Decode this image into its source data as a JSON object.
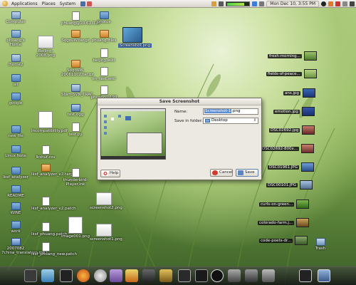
{
  "top_panel": {
    "menus": [
      "Applications",
      "Places",
      "System"
    ],
    "datetime": "Mon Dec 10,  3:55 PM"
  },
  "desktop_left": [
    {
      "label": "Computer",
      "icon": "computer-icon"
    },
    {
      "label": "phuang's Home",
      "icon": "home-icon"
    },
    {
      "label": "/home2",
      "icon": "drive-icon"
    },
    {
      "label": "all",
      "icon": "folder-icon"
    },
    {
      "label": "google",
      "icon": "folder-icon"
    },
    {
      "label": "new file",
      "icon": "folder-icon"
    },
    {
      "label": "Linux Note",
      "icon": "folder-icon"
    },
    {
      "label": "lksf_analyzer",
      "icon": "folder-icon"
    },
    {
      "label": "README",
      "icon": "folder-icon"
    },
    {
      "label": "WINE",
      "icon": "folder-icon"
    },
    {
      "label": "work",
      "icon": "folder-icon"
    },
    {
      "label": "2007082 7china_translation.mp3",
      "icon": "music-file-icon"
    }
  ],
  "desktop_col2": [
    {
      "label": "Beijing-2008.png",
      "icon": "image-file-icon"
    },
    {
      "label": "Incompatibility.pdf",
      "icon": "pdf-file-icon"
    },
    {
      "label": "lkshuf.csv",
      "icon": "document-icon"
    },
    {
      "label": "lksf_analyzer_v2.targz",
      "icon": "archive-icon"
    },
    {
      "label": "lksf_analyzer_v2.patch",
      "icon": "document-icon"
    },
    {
      "label": "lksf_phuang.patch",
      "icon": "document-icon"
    },
    {
      "label": "lksf_phuang_new.patch",
      "icon": "document-icon"
    }
  ],
  "desktop_col3": [
    {
      "label": "phuang@10.61.0.87",
      "icon": "network-icon"
    },
    {
      "label": "SogouW.tar.gz",
      "icon": "archive-icon"
    },
    {
      "label": "SogouW. 20061102.tar.gz",
      "icon": "archive-icon"
    },
    {
      "label": "Start_SVN_TRAC",
      "icon": "script-icon"
    },
    {
      "label": "test.ogg",
      "icon": "music-file-icon"
    },
    {
      "label": "test.py",
      "icon": "document-icon"
    },
    {
      "label": "thunderbird-Player.lnk",
      "icon": "document-icon"
    },
    {
      "label": "Image001.png",
      "icon": "image-file-icon"
    }
  ],
  "desktop_col4": [
    {
      "label": "photos",
      "icon": "folder-icon"
    },
    {
      "label": "phuang_files",
      "icon": "folder-icon"
    },
    {
      "label": "beijing.wiki",
      "icon": "document-icon"
    },
    {
      "label": "im_test.wiki",
      "icon": "document-icon"
    },
    {
      "label": "phuang@199",
      "icon": "network-icon"
    },
    {
      "label": "screenshot2.png",
      "icon": "image-file-icon"
    },
    {
      "label": "screenshot1.png",
      "icon": "image-file-icon"
    }
  ],
  "selected_icon": {
    "label": "Screenshot.png"
  },
  "right_thumbs": [
    "fresh-morning...",
    "fields-of-peace...",
    "ans.jpg",
    "emotion.jpg",
    "DSC02692.jpg",
    "DSC02692-800x...",
    "DSC01961.JPG",
    "DSC00101.JPG",
    "curls-on-green...",
    "colorado-farm.j...",
    "code-poets-dr...",
    "Trash"
  ],
  "dialog": {
    "title": "Save Screenshot",
    "name_label": "Name:",
    "name_selected": "Screenshot-1",
    "name_ext": ".png",
    "folder_label": "Save in folder:",
    "folder_value": "Desktop",
    "help": "Help",
    "cancel": "Cancel",
    "save": "Save"
  },
  "dock_icons": [
    "terminal-icon",
    "browser-icon",
    "firefox-icon",
    "clock-icon",
    "chat-icon",
    "settings-icon",
    "calc-icon",
    "photo-icon",
    "pencil-icon",
    "monitor-icon",
    "terminal-icon",
    "camera-icon",
    "app-icon",
    "camera-icon",
    "terminal-icon",
    "app-icon",
    "screenshot-icon"
  ]
}
